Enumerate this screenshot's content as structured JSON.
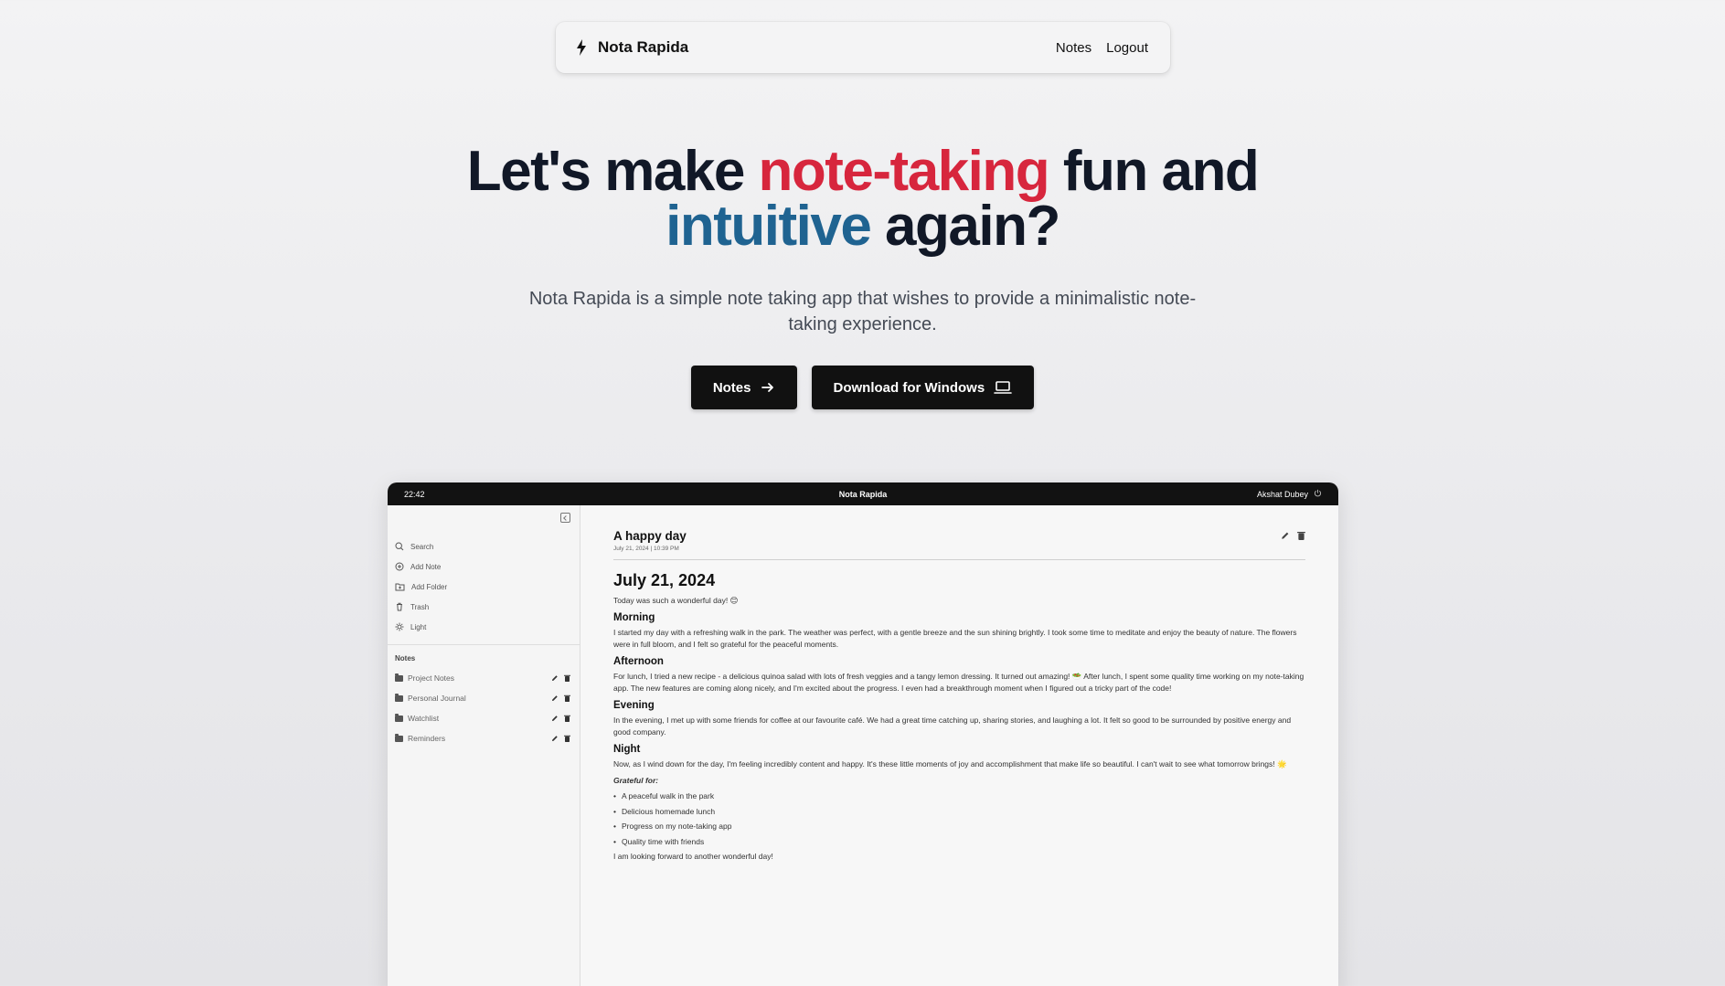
{
  "nav": {
    "brand": "Nota Rapida",
    "links": [
      "Notes",
      "Logout"
    ]
  },
  "hero": {
    "title_part1": "Let's make ",
    "title_highlight1": "note-taking",
    "title_part2": " fun and",
    "title_highlight2": "intuitive",
    "title_part3": " again?",
    "subtitle": "Nota Rapida is a simple note taking app that wishes to provide a minimalistic note-taking experience.",
    "primary_button": "Notes",
    "secondary_button": "Download for Windows"
  },
  "colors": {
    "accent_red": "#d7263d",
    "accent_blue": "#1f6391",
    "button_bg": "#111111"
  },
  "preview": {
    "titlebar": {
      "time": "22:42",
      "app_name": "Nota Rapida",
      "user": "Akshat Dubey"
    },
    "sidebar": {
      "menu": [
        "Search",
        "Add Note",
        "Add Folder",
        "Trash",
        "Light"
      ],
      "section_heading": "Notes",
      "folders": [
        "Project Notes",
        "Personal Journal",
        "Watchlist",
        "Reminders"
      ]
    },
    "note": {
      "title": "A happy day",
      "date": "July 21, 2024 | 10:39 PM",
      "heading": "July 21, 2024",
      "intro": "Today was such a wonderful day! 😊",
      "morning_heading": "Morning",
      "morning_text": "I started my day with a refreshing walk in the park. The weather was perfect, with a gentle breeze and the sun shining brightly. I took some time to meditate and enjoy the beauty of nature. The flowers were in full bloom, and I felt so grateful for the peaceful moments.",
      "afternoon_heading": "Afternoon",
      "afternoon_text": "For lunch, I tried a new recipe - a delicious quinoa salad with lots of fresh veggies and a tangy lemon dressing. It turned out amazing! 🥗 After lunch, I spent some quality time working on my note-taking app. The new features are coming along nicely, and I'm excited about the progress. I even had a breakthrough moment when I figured out a tricky part of the code!",
      "evening_heading": "Evening",
      "evening_text": "In the evening, I met up with some friends for coffee at our favourite café. We had a great time catching up, sharing stories, and laughing a lot. It felt so good to be surrounded by positive energy and good company.",
      "night_heading": "Night",
      "night_text": "Now, as I wind down for the day, I'm feeling incredibly content and happy. It's these little moments of joy and accomplishment that make life so beautiful. I can't wait to see what tomorrow brings! 🌟",
      "grateful_heading": "Grateful for:",
      "grateful_items": [
        "A peaceful walk in the park",
        "Delicious homemade lunch",
        "Progress on my note-taking app",
        "Quality time with friends"
      ],
      "closing": "I am looking forward to another wonderful day!"
    }
  }
}
